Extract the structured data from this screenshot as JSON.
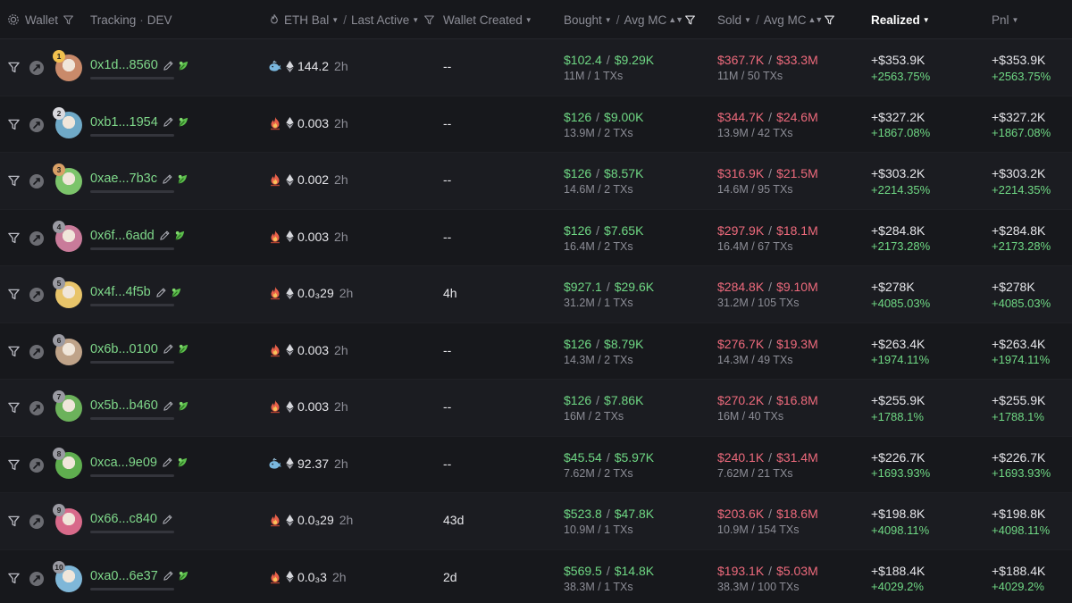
{
  "header": {
    "wallet": "Wallet",
    "tracking": "Tracking",
    "dev": "DEV",
    "eth_bal": "ETH Bal",
    "last_active": "Last Active",
    "wallet_created": "Wallet Created",
    "bought": "Bought",
    "sold": "Sold",
    "avg_mc": "Avg MC",
    "realized": "Realized",
    "pnl": "Pnl",
    "slash": "/"
  },
  "colors": {
    "green": "#6fd884",
    "red": "#ee6a7c",
    "bg": "#17181c",
    "row_alt": "#1b1c21"
  },
  "rows": [
    {
      "rank": "1",
      "rank_color": "#f2c14e",
      "avatar": "#c98a6a",
      "address": "0x1d...8560",
      "leaf": true,
      "bal_icon": "whale-icon",
      "eth_bal": "144.2",
      "last_active": "2h",
      "created": "--",
      "bought": "$102.4",
      "bought_mc": "$9.29K",
      "bought_sub": "11M / 1 TXs",
      "sold": "$367.7K",
      "sold_mc": "$33.3M",
      "sold_sub": "11M / 50 TXs",
      "realized": "+$353.9K",
      "realized_pct": "+2563.75%",
      "pnl": "+$353.9K",
      "pnl_pct": "+2563.75%"
    },
    {
      "rank": "2",
      "rank_color": "#d9d9de",
      "avatar": "#6fa9c7",
      "address": "0xb1...1954",
      "leaf": true,
      "bal_icon": "fire-icon",
      "eth_bal": "0.003",
      "last_active": "2h",
      "created": "--",
      "bought": "$126",
      "bought_mc": "$9.00K",
      "bought_sub": "13.9M / 2 TXs",
      "sold": "$344.7K",
      "sold_mc": "$24.6M",
      "sold_sub": "13.9M / 42 TXs",
      "realized": "+$327.2K",
      "realized_pct": "+1867.08%",
      "pnl": "+$327.2K",
      "pnl_pct": "+1867.08%"
    },
    {
      "rank": "3",
      "rank_color": "#d9a066",
      "avatar": "#7cc46b",
      "address": "0xae...7b3c",
      "leaf": true,
      "bal_icon": "fire-icon",
      "eth_bal": "0.002",
      "last_active": "2h",
      "created": "--",
      "bought": "$126",
      "bought_mc": "$8.57K",
      "bought_sub": "14.6M / 2 TXs",
      "sold": "$316.9K",
      "sold_mc": "$21.5M",
      "sold_sub": "14.6M / 95 TXs",
      "realized": "+$303.2K",
      "realized_pct": "+2214.35%",
      "pnl": "+$303.2K",
      "pnl_pct": "+2214.35%"
    },
    {
      "rank": "4",
      "rank_color": "#9a9aa2",
      "avatar": "#c97b9a",
      "address": "0x6f...6add",
      "leaf": true,
      "bal_icon": "fire-icon",
      "eth_bal": "0.003",
      "last_active": "2h",
      "created": "--",
      "bought": "$126",
      "bought_mc": "$7.65K",
      "bought_sub": "16.4M / 2 TXs",
      "sold": "$297.9K",
      "sold_mc": "$18.1M",
      "sold_sub": "16.4M / 67 TXs",
      "realized": "+$284.8K",
      "realized_pct": "+2173.28%",
      "pnl": "+$284.8K",
      "pnl_pct": "+2173.28%"
    },
    {
      "rank": "5",
      "rank_color": "#9a9aa2",
      "avatar": "#e8c46a",
      "address": "0x4f...4f5b",
      "leaf": true,
      "bal_icon": "fire-icon",
      "eth_bal": "0.0₃29",
      "last_active": "2h",
      "created": "4h",
      "bought": "$927.1",
      "bought_mc": "$29.6K",
      "bought_sub": "31.2M / 1 TXs",
      "sold": "$284.8K",
      "sold_mc": "$9.10M",
      "sold_sub": "31.2M / 105 TXs",
      "realized": "+$278K",
      "realized_pct": "+4085.03%",
      "pnl": "+$278K",
      "pnl_pct": "+4085.03%"
    },
    {
      "rank": "6",
      "rank_color": "#9a9aa2",
      "avatar": "#bfa389",
      "address": "0x6b...0100",
      "leaf": true,
      "bal_icon": "fire-icon",
      "eth_bal": "0.003",
      "last_active": "2h",
      "created": "--",
      "bought": "$126",
      "bought_mc": "$8.79K",
      "bought_sub": "14.3M / 2 TXs",
      "sold": "$276.7K",
      "sold_mc": "$19.3M",
      "sold_sub": "14.3M / 49 TXs",
      "realized": "+$263.4K",
      "realized_pct": "+1974.11%",
      "pnl": "+$263.4K",
      "pnl_pct": "+1974.11%"
    },
    {
      "rank": "7",
      "rank_color": "#9a9aa2",
      "avatar": "#6cb25b",
      "address": "0x5b...b460",
      "leaf": true,
      "bal_icon": "fire-icon",
      "eth_bal": "0.003",
      "last_active": "2h",
      "created": "--",
      "bought": "$126",
      "bought_mc": "$7.86K",
      "bought_sub": "16M / 2 TXs",
      "sold": "$270.2K",
      "sold_mc": "$16.8M",
      "sold_sub": "16M / 40 TXs",
      "realized": "+$255.9K",
      "realized_pct": "+1788.1%",
      "pnl": "+$255.9K",
      "pnl_pct": "+1788.1%"
    },
    {
      "rank": "8",
      "rank_color": "#9a9aa2",
      "avatar": "#5fae4f",
      "address": "0xca...9e09",
      "leaf": true,
      "bal_icon": "whale-icon",
      "eth_bal": "92.37",
      "last_active": "2h",
      "created": "--",
      "bought": "$45.54",
      "bought_mc": "$5.97K",
      "bought_sub": "7.62M / 2 TXs",
      "sold": "$240.1K",
      "sold_mc": "$31.4M",
      "sold_sub": "7.62M / 21 TXs",
      "realized": "+$226.7K",
      "realized_pct": "+1693.93%",
      "pnl": "+$226.7K",
      "pnl_pct": "+1693.93%"
    },
    {
      "rank": "9",
      "rank_color": "#9a9aa2",
      "avatar": "#d86a8a",
      "address": "0x66...c840",
      "leaf": false,
      "bal_icon": "fire-icon",
      "eth_bal": "0.0₃29",
      "last_active": "2h",
      "created": "43d",
      "bought": "$523.8",
      "bought_mc": "$47.8K",
      "bought_sub": "10.9M / 1 TXs",
      "sold": "$203.6K",
      "sold_mc": "$18.6M",
      "sold_sub": "10.9M / 154 TXs",
      "realized": "+$198.8K",
      "realized_pct": "+4098.11%",
      "pnl": "+$198.8K",
      "pnl_pct": "+4098.11%"
    },
    {
      "rank": "10",
      "rank_color": "#9a9aa2",
      "avatar": "#7fb7d8",
      "address": "0xa0...6e37",
      "leaf": true,
      "bal_icon": "fire-icon",
      "eth_bal": "0.0₃3",
      "last_active": "2h",
      "created": "2d",
      "bought": "$569.5",
      "bought_mc": "$14.8K",
      "bought_sub": "38.3M / 1 TXs",
      "sold": "$193.1K",
      "sold_mc": "$5.03M",
      "sold_sub": "38.3M / 100 TXs",
      "realized": "+$188.4K",
      "realized_pct": "+4029.2%",
      "pnl": "+$188.4K",
      "pnl_pct": "+4029.2%"
    }
  ]
}
